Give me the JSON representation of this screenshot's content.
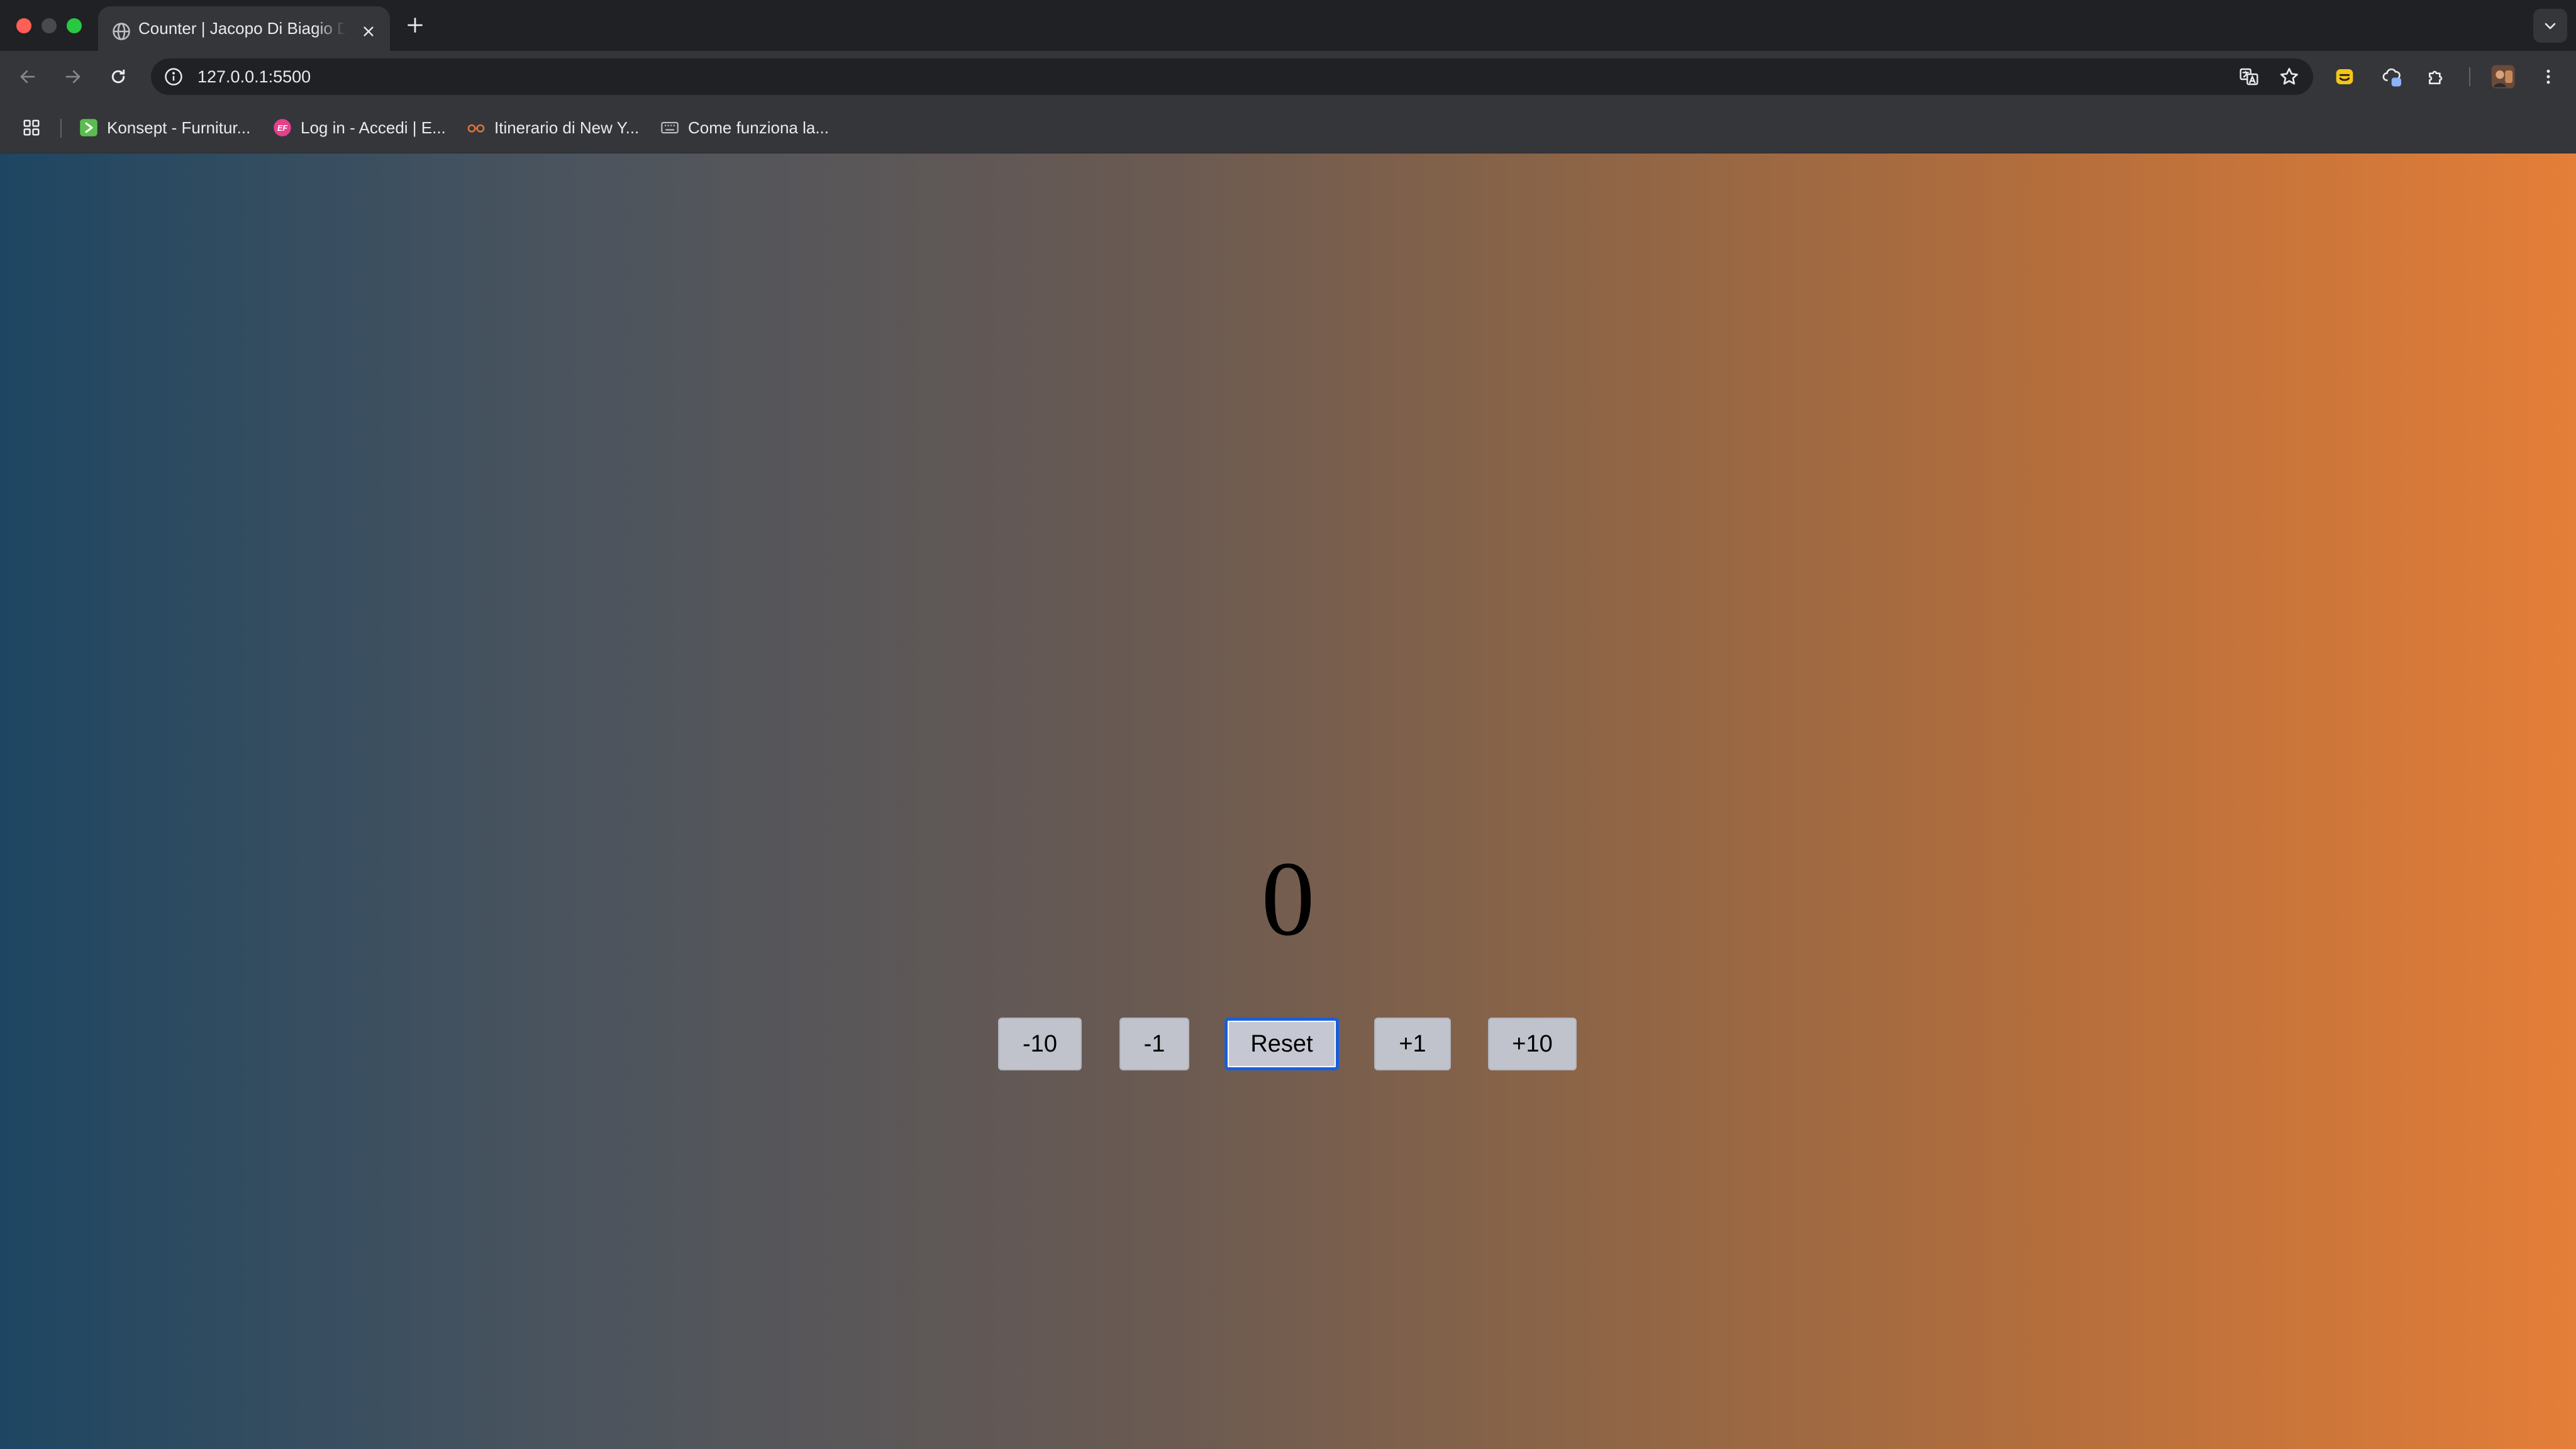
{
  "browser": {
    "tab": {
      "title": "Counter | Jacopo Di Biagio Dev",
      "icon": "globe-icon"
    },
    "new_tab_icon": "plus-icon",
    "address_bar": {
      "url": "127.0.0.1:5500",
      "icon": "info-icon"
    },
    "nav_icons": [
      "back-arrow-icon",
      "forward-arrow-icon",
      "reload-icon"
    ],
    "toolbar_icons": [
      "translate-icon",
      "star-icon",
      "extension-yellow-icon",
      "extension-cloud-icon",
      "puzzle-icon",
      "profile-avatar",
      "more-vert-icon"
    ],
    "bookmarks": [
      {
        "label": "Konsept - Furnitur...",
        "icon": "konsept-favicon",
        "color": "#5bbd4f"
      },
      {
        "label": "Log in - Accedi | E...",
        "icon": "ef-favicon",
        "color": "#e4408b"
      },
      {
        "label": "Itinerario di New Y...",
        "icon": "glasses-favicon",
        "color": "#e0713b"
      },
      {
        "label": "Come funziona la...",
        "icon": "keyboard-favicon",
        "color": "#bdc1c6"
      }
    ]
  },
  "counter": {
    "value": "0",
    "buttons": {
      "minus_ten": "-10",
      "minus_one": "-1",
      "reset": "Reset",
      "plus_one": "+1",
      "plus_ten": "+10"
    }
  },
  "colors": {
    "gradient_left": "#1e4662",
    "gradient_right": "#e47e38",
    "button_bg": "#c1c3cc",
    "focus_ring": "#1a5fd9"
  }
}
